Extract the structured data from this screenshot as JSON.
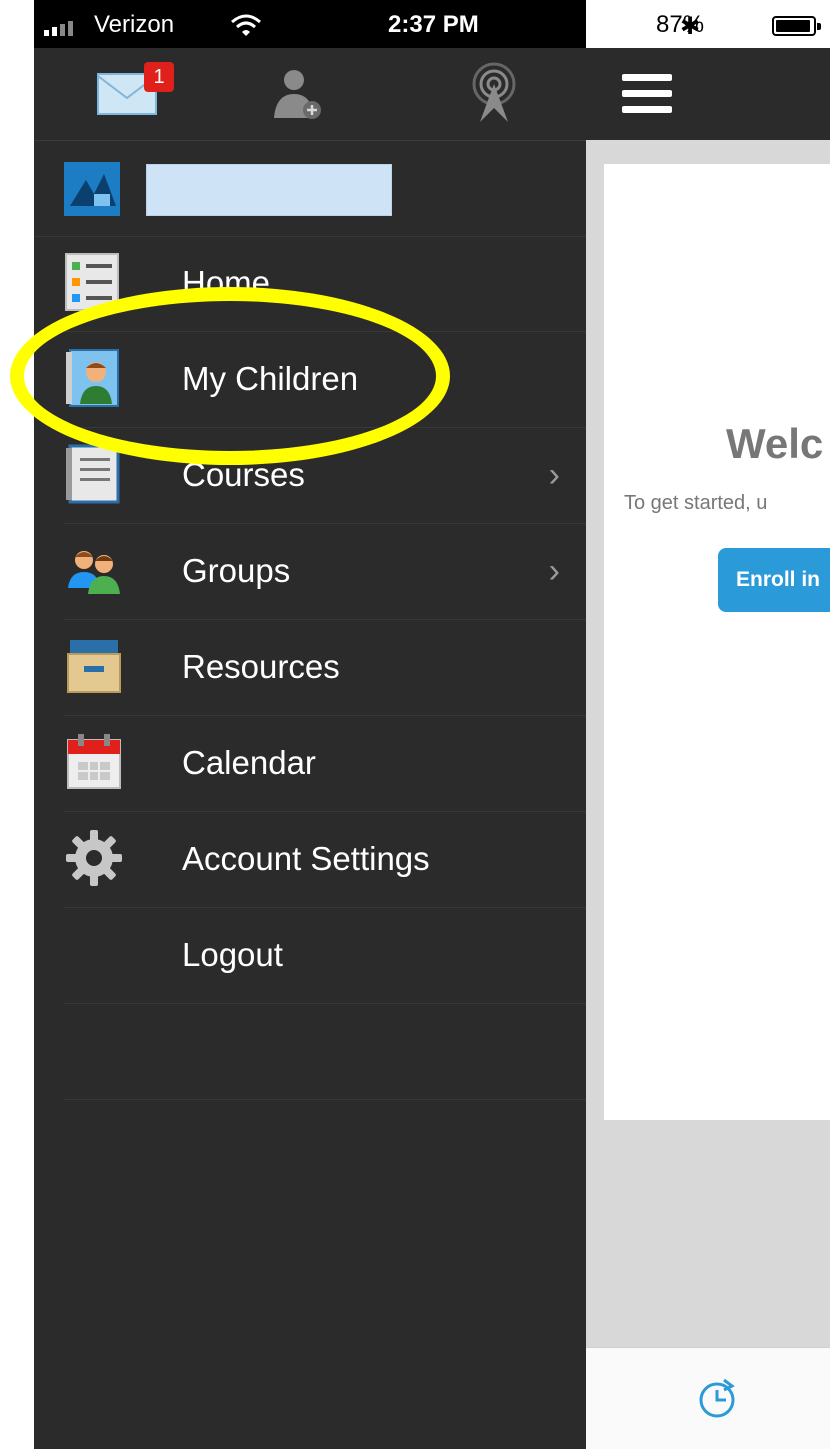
{
  "status_bar": {
    "carrier": "Verizon",
    "time": "2:37 PM",
    "battery_pct": "87%"
  },
  "toolbar": {
    "messages_badge": "1",
    "icons": [
      "mail-icon",
      "add-contact-icon",
      "broadcast-icon"
    ]
  },
  "sidebar": {
    "items": [
      {
        "label": "Home",
        "icon": "home-icon",
        "chevron": ""
      },
      {
        "label": "My Children",
        "icon": "children-icon",
        "chevron": ""
      },
      {
        "label": "Courses",
        "icon": "courses-icon",
        "chevron": "›"
      },
      {
        "label": "Groups",
        "icon": "groups-icon",
        "chevron": "›"
      },
      {
        "label": "Resources",
        "icon": "resources-icon",
        "chevron": ""
      },
      {
        "label": "Calendar",
        "icon": "calendar-icon",
        "chevron": ""
      },
      {
        "label": "Account Settings",
        "icon": "gear-icon",
        "chevron": ""
      },
      {
        "label": "Logout",
        "icon": "",
        "chevron": ""
      }
    ]
  },
  "main": {
    "welcome": "Welc",
    "subtext": "To get started, u",
    "enroll_label": "Enroll in"
  },
  "colors": {
    "sidebar_bg": "#2b2b2b",
    "highlight": "#ffff00",
    "accent_button": "#2b9ad8",
    "badge": "#e0201b"
  }
}
